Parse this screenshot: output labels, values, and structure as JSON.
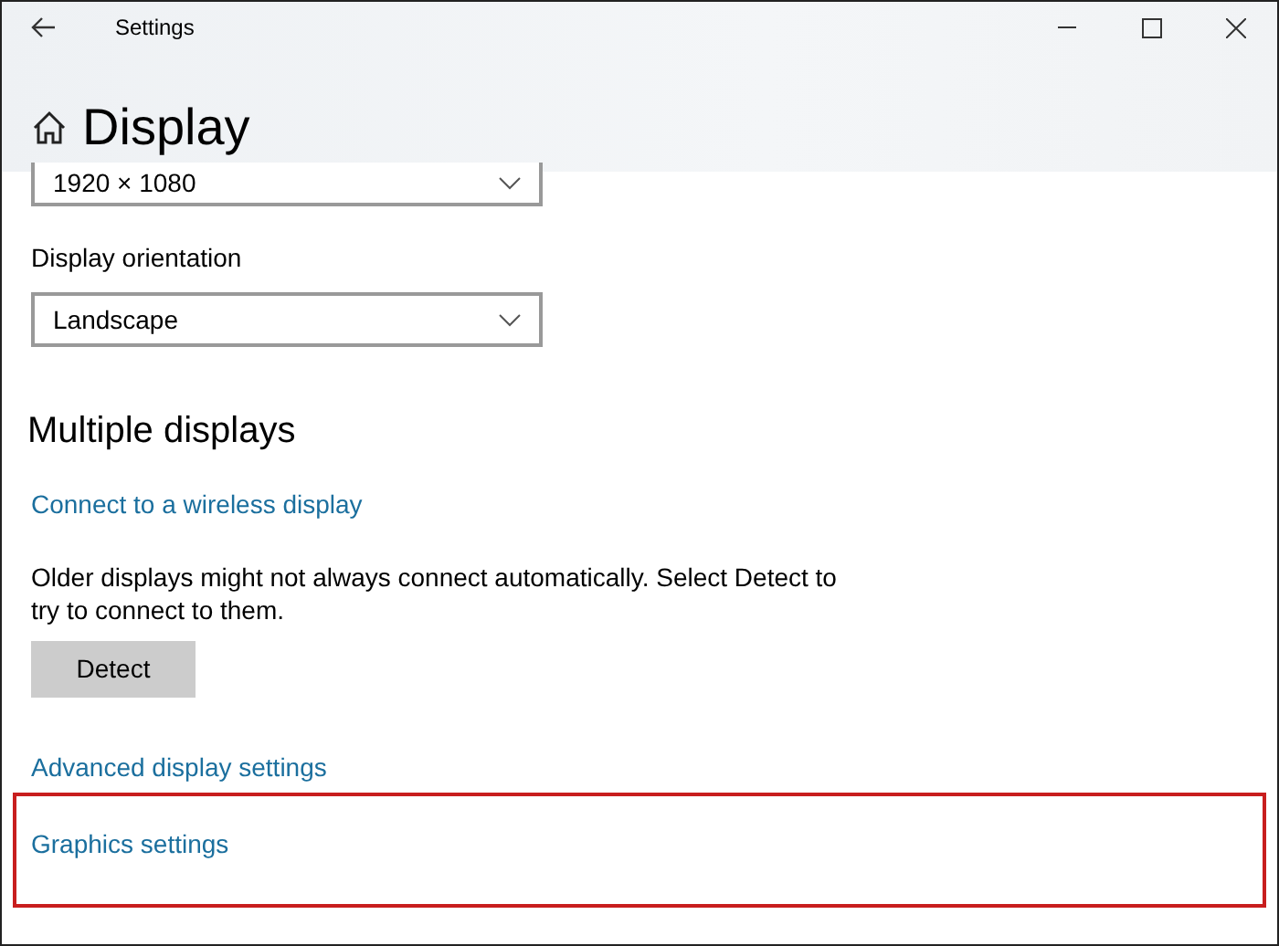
{
  "window": {
    "title": "Settings"
  },
  "page": {
    "title": "Display"
  },
  "dropdowns": [
    {
      "value": "1920 × 1080",
      "cut_top": true
    },
    {
      "label": "Display orientation",
      "value": "Landscape",
      "cut_top": false
    }
  ],
  "section": {
    "title": "Multiple displays"
  },
  "items": [
    {
      "kind": "link",
      "text": "Connect to a wireless display",
      "highlighted": false
    },
    {
      "kind": "text",
      "text": "Older displays might not always connect automatically. Select Detect to try to connect to them."
    },
    {
      "kind": "button",
      "text": "Detect"
    },
    {
      "kind": "link",
      "text": "Advanced display settings",
      "highlighted": false
    },
    {
      "kind": "link",
      "text": "Graphics settings",
      "highlighted": true
    }
  ]
}
